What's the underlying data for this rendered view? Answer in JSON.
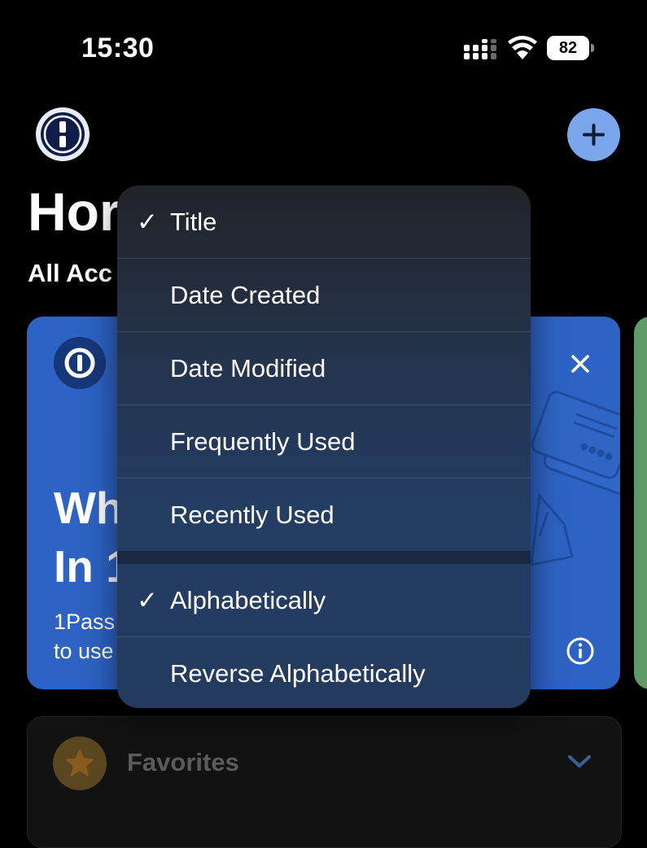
{
  "status_bar": {
    "time": "15:30",
    "battery": "82",
    "icons": [
      "signal-icon",
      "wifi-icon",
      "battery-icon"
    ]
  },
  "header": {
    "logo_icon": "onepassword-logo-icon",
    "add_icon": "plus-icon",
    "title": "Hor",
    "account_filter": "All Acc"
  },
  "welcome_card": {
    "heading": "Wh\nIn 1",
    "body": "1Pass\nto use",
    "close_icon": "close-icon",
    "info_icon": "info-icon",
    "color": "#2d63c4"
  },
  "favorites": {
    "label": "Favorites",
    "icon": "star-icon",
    "expand_icon": "chevron-down-icon"
  },
  "sort_menu": {
    "sort_by": [
      {
        "label": "Title",
        "selected": true,
        "check": "✓"
      },
      {
        "label": "Date Created",
        "selected": false,
        "check": ""
      },
      {
        "label": "Date Modified",
        "selected": false,
        "check": ""
      },
      {
        "label": "Frequently Used",
        "selected": false,
        "check": ""
      },
      {
        "label": "Recently Used",
        "selected": false,
        "check": ""
      }
    ],
    "order": [
      {
        "label": "Alphabetically",
        "selected": true,
        "check": "✓"
      },
      {
        "label": "Reverse Alphabetically",
        "selected": false,
        "check": ""
      }
    ]
  }
}
